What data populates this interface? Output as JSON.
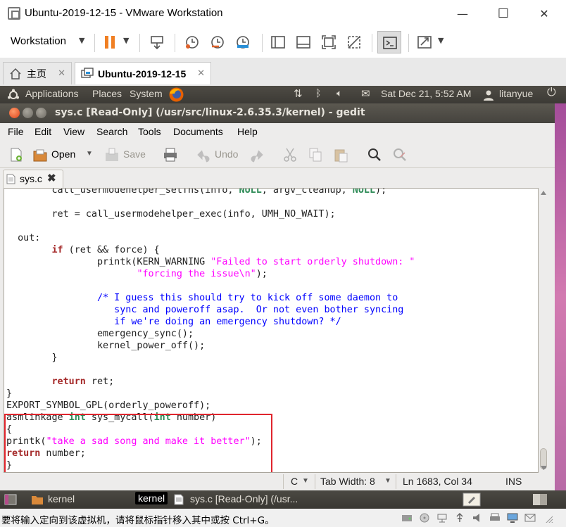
{
  "vm_window": {
    "title": "Ubuntu-2019-12-15 - VMware Workstation",
    "controls": {
      "minimize": "—",
      "maximize": "☐",
      "close": "✕"
    }
  },
  "vm_toolbar": {
    "workstation_menu": "Workstation",
    "icons": [
      "pause-icon",
      "send-keys-icon",
      "snapshot-icon",
      "revert-snapshot-icon",
      "snapshot-manager-icon",
      "show-library-icon",
      "thumbnail-icon",
      "full-screen-icon",
      "unity-icon",
      "console-view-icon",
      "stretch-icon"
    ]
  },
  "vm_tabs": [
    {
      "label": "主页",
      "active": false
    },
    {
      "label": "Ubuntu-2019-12-15",
      "active": true
    }
  ],
  "gnome_panel": {
    "applications": "Applications",
    "places": "Places",
    "system": "System",
    "datetime": "Sat Dec 21,  5:52 AM",
    "user": "litanyue"
  },
  "gedit": {
    "title": "sys.c [Read-Only] (/usr/src/linux-2.6.35.3/kernel) - gedit",
    "menu": [
      "File",
      "Edit",
      "View",
      "Search",
      "Tools",
      "Documents",
      "Help"
    ],
    "toolbar": {
      "open": "Open",
      "save": "Save",
      "undo": "Undo"
    },
    "document_tab": "sys.c",
    "status": {
      "language": "C",
      "tab_width": "Tab Width: 8",
      "position": "Ln 1683, Col 34",
      "mode": "INS"
    }
  },
  "code_lines": [
    [
      {
        "t": "        call_usermodehelper_setfns(info, "
      },
      {
        "t": "NULL",
        "c": "t"
      },
      {
        "t": ", argv_cleanup, "
      },
      {
        "t": "NULL",
        "c": "t"
      },
      {
        "t": ");"
      }
    ],
    [
      {
        "t": ""
      }
    ],
    [
      {
        "t": "        ret = call_usermodehelper_exec(info, UMH_NO_WAIT);"
      }
    ],
    [
      {
        "t": ""
      }
    ],
    [
      {
        "t": "  out:"
      }
    ],
    [
      {
        "t": "        "
      },
      {
        "t": "if",
        "c": "k"
      },
      {
        "t": " (ret && force) {"
      }
    ],
    [
      {
        "t": "                printk(KERN_WARNING "
      },
      {
        "t": "\"Failed to start orderly shutdown: \"",
        "c": "s"
      }
    ],
    [
      {
        "t": "                       "
      },
      {
        "t": "\"forcing the issue\\n\"",
        "c": "s"
      },
      {
        "t": ");"
      }
    ],
    [
      {
        "t": ""
      }
    ],
    [
      {
        "t": "                "
      },
      {
        "t": "/* I guess this should try to kick off some daemon to",
        "c": "c"
      }
    ],
    [
      {
        "t": "                   sync and poweroff asap.  Or not even bother syncing",
        "c": "c"
      }
    ],
    [
      {
        "t": "                   if we're doing an emergency shutdown? */",
        "c": "c"
      }
    ],
    [
      {
        "t": "                emergency_sync();"
      }
    ],
    [
      {
        "t": "                kernel_power_off();"
      }
    ],
    [
      {
        "t": "        }"
      }
    ],
    [
      {
        "t": ""
      }
    ],
    [
      {
        "t": "        "
      },
      {
        "t": "return",
        "c": "k"
      },
      {
        "t": " ret;"
      }
    ],
    [
      {
        "t": "}"
      }
    ],
    [
      {
        "t": "EXPORT_SYMBOL_GPL(orderly_poweroff);"
      }
    ],
    [
      {
        "t": "asmlinkage "
      },
      {
        "t": "int",
        "c": "t"
      },
      {
        "t": " sys_mycall("
      },
      {
        "t": "int",
        "c": "t"
      },
      {
        "t": " number)"
      }
    ],
    [
      {
        "t": "{"
      }
    ],
    [
      {
        "t": "printk("
      },
      {
        "t": "\"take a sad song and make it better\"",
        "c": "s"
      },
      {
        "t": ");"
      }
    ],
    [
      {
        "t": "return",
        "c": "k"
      },
      {
        "t": " number;"
      }
    ],
    [
      {
        "t": "}"
      }
    ]
  ],
  "bottom_taskbar": {
    "item1": "kernel",
    "tooltip": "kernel",
    "item2": "sys.c [Read-Only] (/usr..."
  },
  "vm_statusbar": {
    "message": "要将输入定向到该虚拟机，请将鼠标指针移入其中或按 Ctrl+G。"
  },
  "colors": {
    "keyword": "#a52a2a",
    "type": "#2e8b57",
    "string": "#ff00ff",
    "comment": "#0000ff",
    "highlight_box": "#e0252d",
    "pause_orange": "#f07f23"
  }
}
